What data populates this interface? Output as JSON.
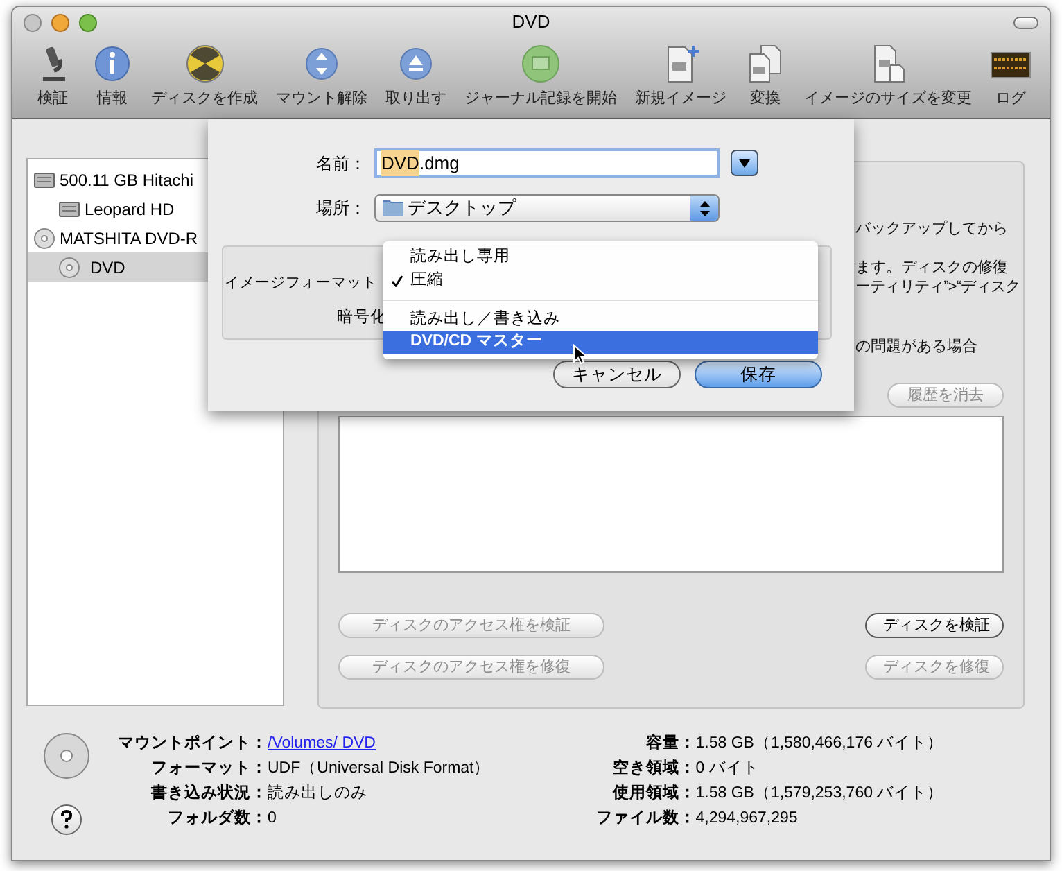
{
  "window": {
    "title": "DVD"
  },
  "toolbar": [
    {
      "label": "検証",
      "kind": "microscope"
    },
    {
      "label": "情報",
      "kind": "info"
    },
    {
      "label": "ディスクを作成",
      "kind": "burn"
    },
    {
      "label": "マウント解除",
      "kind": "unmount"
    },
    {
      "label": "取り出す",
      "kind": "eject"
    },
    {
      "label": "ジャーナル記録を開始",
      "kind": "journal"
    },
    {
      "label": "新規イメージ",
      "kind": "newimage"
    },
    {
      "label": "変換",
      "kind": "convert"
    },
    {
      "label": "イメージのサイズを変更",
      "kind": "resize"
    },
    {
      "label": "ログ",
      "kind": "log"
    }
  ],
  "sidebar": {
    "items": [
      {
        "label": "500.11 GB Hitachi",
        "kind": "disk",
        "selected": false,
        "children": [
          {
            "label": "Leopard HD",
            "kind": "disk",
            "selected": false
          }
        ]
      },
      {
        "label": "MATSHITA DVD-R",
        "kind": "optical",
        "selected": false,
        "children": [
          {
            "label": "DVD",
            "kind": "optical",
            "selected": true
          }
        ]
      }
    ]
  },
  "panel": {
    "text_fragments": [
      "バックアップしてから",
      "ます。ディスクの修復",
      "ーティリティ”>“ディスク",
      "の問題がある場合"
    ],
    "clear_button": {
      "label": "履歴を消去",
      "disabled": true
    },
    "buttons": [
      {
        "label": "ディスクのアクセス権を検証",
        "disabled": true
      },
      {
        "label": "ディスクを検証",
        "disabled": false
      },
      {
        "label": "ディスクのアクセス権を修復",
        "disabled": true
      },
      {
        "label": "ディスクを修復",
        "disabled": true
      }
    ]
  },
  "sheet": {
    "name_label": "名前：",
    "name_selected": "DVD",
    "name_rest": ".dmg",
    "location_label": "場所：",
    "location_value": "デスクトップ",
    "format_label": "イメージフォーマット",
    "encryption_label": "暗号化",
    "menu": [
      {
        "label": "読み出し専用",
        "checked": false,
        "selected": false,
        "separator_after": false
      },
      {
        "label": "圧縮",
        "checked": true,
        "selected": false,
        "separator_after": true
      },
      {
        "label": "読み出し／書き込み",
        "checked": false,
        "selected": false,
        "separator_after": false
      },
      {
        "label": "DVD/CD マスター",
        "checked": false,
        "selected": true,
        "separator_after": false
      }
    ],
    "buttons": [
      {
        "label": "キャンセル",
        "default": false
      },
      {
        "label": "保存",
        "default": true
      }
    ]
  },
  "info": {
    "left": [
      {
        "label": "マウントポイント：",
        "value": "/Volumes/ DVD",
        "kind": "link"
      },
      {
        "label": "フォーマット：",
        "value": "UDF（Universal Disk Format）",
        "kind": "text"
      },
      {
        "label": "書き込み状況：",
        "value": "読み出しのみ",
        "kind": "text"
      },
      {
        "label": "フォルダ数：",
        "value": "0",
        "kind": "text"
      }
    ],
    "right": [
      {
        "label": "容量：",
        "value": "1.58 GB（1,580,466,176 バイト）",
        "kind": "text"
      },
      {
        "label": "空き領域：",
        "value": "0 バイト",
        "kind": "text"
      },
      {
        "label": "使用領域：",
        "value": "1.58 GB（1,579,253,760 バイト）",
        "kind": "text"
      },
      {
        "label": "ファイル数：",
        "value": "4,294,967,295",
        "kind": "text"
      }
    ]
  }
}
